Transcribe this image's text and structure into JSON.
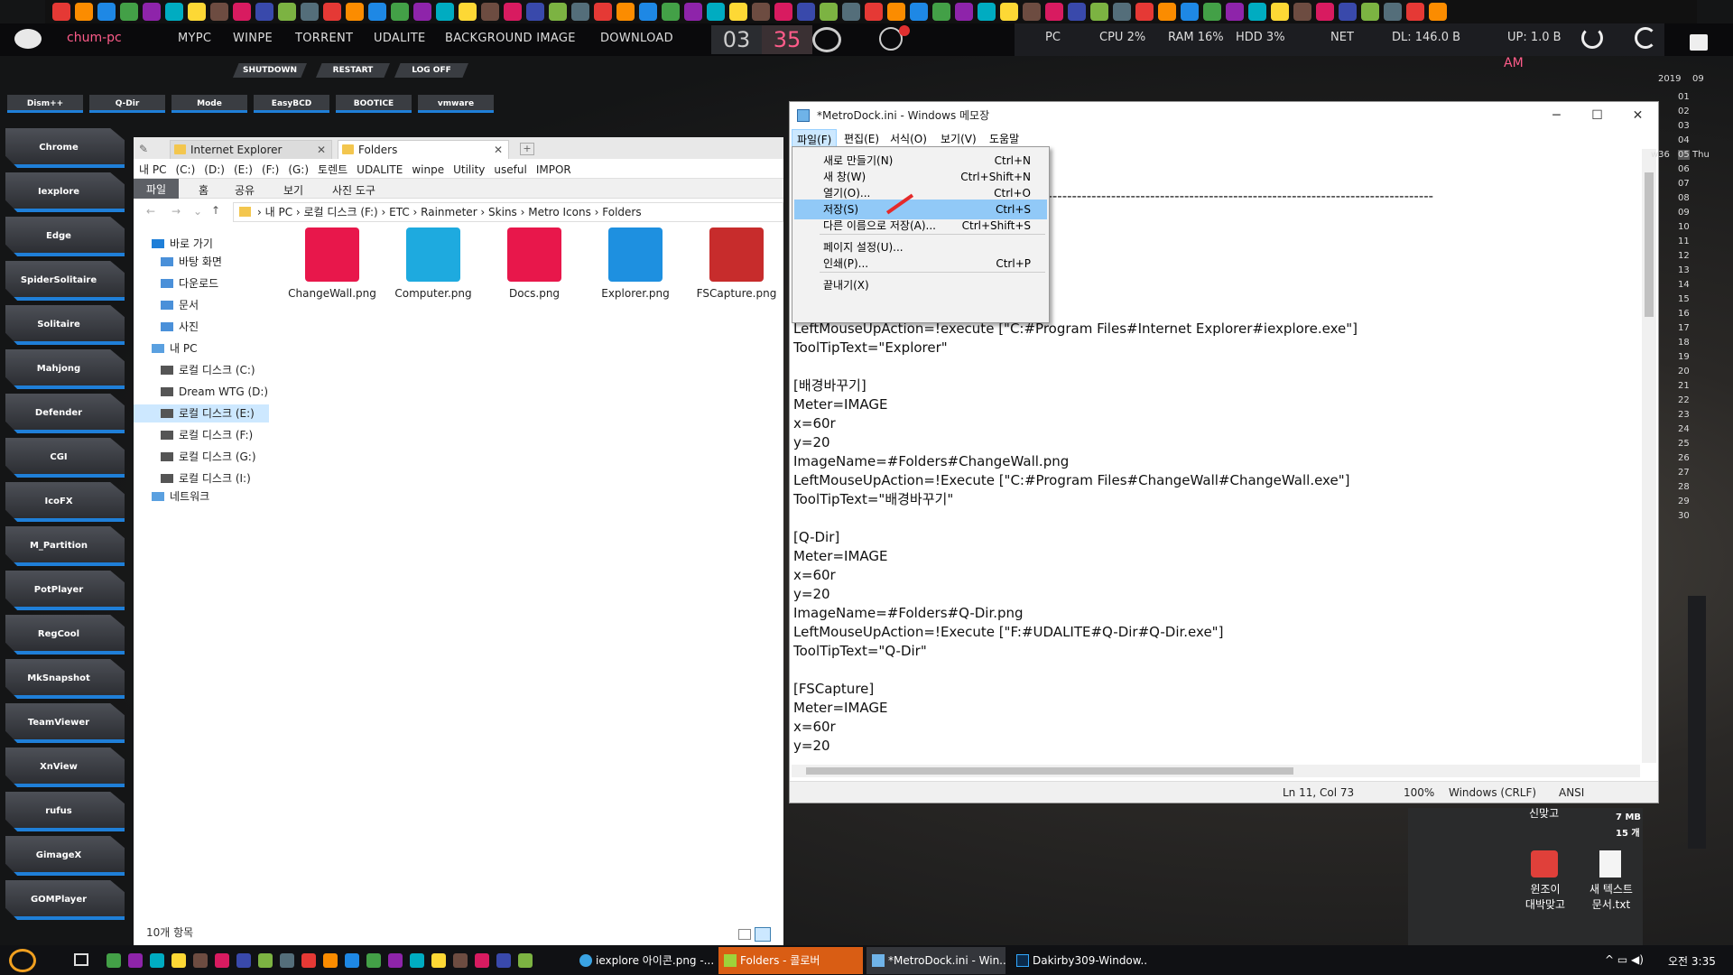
{
  "colors": {
    "accent": "#1f7fd8",
    "pink": "#ff5c8a",
    "highlight": "#91c9f7"
  },
  "topbar": {
    "host": "chum-pc",
    "menu": [
      "MYPC",
      "WINPE",
      "TORRENT",
      "UDALITE",
      "BACKGROUND IMAGE",
      "DOWNLOAD"
    ],
    "clock_h": "03",
    "clock_m": "35",
    "ampm": "AM",
    "pc": "PC",
    "cpu": "CPU  2%",
    "ram": "RAM  16%",
    "hdd": "HDD  3%",
    "net": "NET",
    "dl": "DL: 146.0 B",
    "up": "UP: 1.0 B",
    "icons": [
      "power-icon",
      "refresh-icon",
      "lock-icon"
    ]
  },
  "power_buttons": [
    "SHUTDOWN",
    "RESTART",
    "LOG OFF"
  ],
  "launcher": [
    "Dism++",
    "Q-Dir",
    "Mode",
    "EasyBCD",
    "BOOTICE",
    "vmware"
  ],
  "dock": [
    "Chrome",
    "Iexplore",
    "Edge",
    "SpiderSolitaire",
    "Solitaire",
    "Mahjong",
    "Defender",
    "CGI",
    "IcoFX",
    "M_Partition",
    "PotPlayer",
    "RegCool",
    "MkSnapshot",
    "TeamViewer",
    "XnView",
    "rufus",
    "GimageX",
    "GOMPlayer"
  ],
  "explorer": {
    "tabs": [
      "Internet Explorer",
      "Folders"
    ],
    "favorites": [
      "내 PC",
      "(C:)",
      "(D:)",
      "(E:)",
      "(F:)",
      "(G:)",
      "토렌트",
      "UDALITE",
      "winpe",
      "Utility",
      "useful",
      "IMPOR"
    ],
    "ribbon": [
      "파일",
      "홈",
      "공유",
      "보기",
      "사진 도구"
    ],
    "breadcrumb": "›  내 PC  ›  로컬 디스크 (F:)  ›  ETC  ›  Rainmeter  ›  Skins  ›  Metro Icons  ›  Folders",
    "nav": {
      "quick": "바로 가기",
      "quick_items": [
        "바탕 화면",
        "다운로드",
        "문서",
        "사진"
      ],
      "pc": "내 PC",
      "drives": [
        "로컬 디스크 (C:)",
        "Dream WTG (D:)",
        "로컬 디스크 (E:)",
        "로컬 디스크 (F:)",
        "로컬 디스크 (G:)",
        "로컬 디스크 (I:)"
      ],
      "network": "네트워크"
    },
    "files": [
      {
        "name": "ChangeWall.png",
        "color": "#e8174b"
      },
      {
        "name": "Computer.png",
        "color": "#1eaadf"
      },
      {
        "name": "Docs.png",
        "color": "#e8174b"
      },
      {
        "name": "Explorer.png",
        "color": "#1e90e0"
      },
      {
        "name": "FSCapture.png",
        "color": "#c72c2c"
      }
    ],
    "status": "10개 항목"
  },
  "notepad": {
    "title": "*MetroDock.ini - Windows 메모장",
    "menu": [
      "파일(F)",
      "편집(E)",
      "서식(O)",
      "보기(V)",
      "도움말"
    ],
    "file_menu": [
      {
        "label": "새로 만들기(N)",
        "shortcut": "Ctrl+N"
      },
      {
        "label": "새 창(W)",
        "shortcut": "Ctrl+Shift+N"
      },
      {
        "label": "열기(O)...",
        "shortcut": "Ctrl+O"
      },
      {
        "label": "저장(S)",
        "shortcut": "Ctrl+S"
      },
      {
        "label": "다른 이름으로 저장(A)...",
        "shortcut": "Ctrl+Shift+S"
      },
      {
        "label": "페이지 설정(U)...",
        "shortcut": ""
      },
      {
        "label": "인쇄(P)...",
        "shortcut": "Ctrl+P"
      },
      {
        "label": "끝내기(X)",
        "shortcut": ""
      }
    ],
    "text": "                                                    m\n\n-----------------------------------------------------------------------------------------------------------------------------------\n\n\n\n\n\nImageName=#Folders#Explorer.png\nLeftMouseUpAction=!execute [\"C:#Program Files#Internet Explorer#iexplore.exe\"]\nToolTipText=\"Explorer\"\n\n[배경바꾸기]\nMeter=IMAGE\nx=60r\ny=20\nImageName=#Folders#ChangeWall.png\nLeftMouseUpAction=!Execute [\"C:#Program Files#ChangeWall#ChangeWall.exe\"]\nToolTipText=\"배경바꾸기\"\n\n[Q-Dir]\nMeter=IMAGE\nx=60r\ny=20\nImageName=#Folders#Q-Dir.png\nLeftMouseUpAction=!Execute [\"F:#UDALITE#Q-Dir#Q-Dir.exe\"]\nToolTipText=\"Q-Dir\"\n\n[FSCapture]\nMeter=IMAGE\nx=60r\ny=20",
    "status": {
      "pos": "Ln 11, Col 73",
      "zoom": "100%",
      "eol": "Windows (CRLF)",
      "enc": "ANSI"
    }
  },
  "calendar": {
    "year": "2019",
    "month": "09",
    "week": "w36",
    "dow": "Thu",
    "days": [
      "01",
      "02",
      "03",
      "04",
      "05",
      "06",
      "07",
      "08",
      "09",
      "10",
      "11",
      "12",
      "13",
      "14",
      "15",
      "16",
      "17",
      "18",
      "19",
      "20",
      "21",
      "22",
      "23",
      "24",
      "25",
      "26",
      "27",
      "28",
      "29",
      "30"
    ]
  },
  "desktop_icons": [
    {
      "label": "윈조이\n대박맞고"
    },
    {
      "label": "새 텍스트\n문서.txt"
    }
  ],
  "desktop_misc": [
    "신맞고",
    "7 MB",
    "15 개"
  ],
  "taskbar": {
    "items": [
      "iexplore 아이콘.png -...",
      "Folders - 콜로버",
      "*MetroDock.ini - Win...",
      "Dakirby309-Window..."
    ],
    "time": "오전 3:35"
  }
}
